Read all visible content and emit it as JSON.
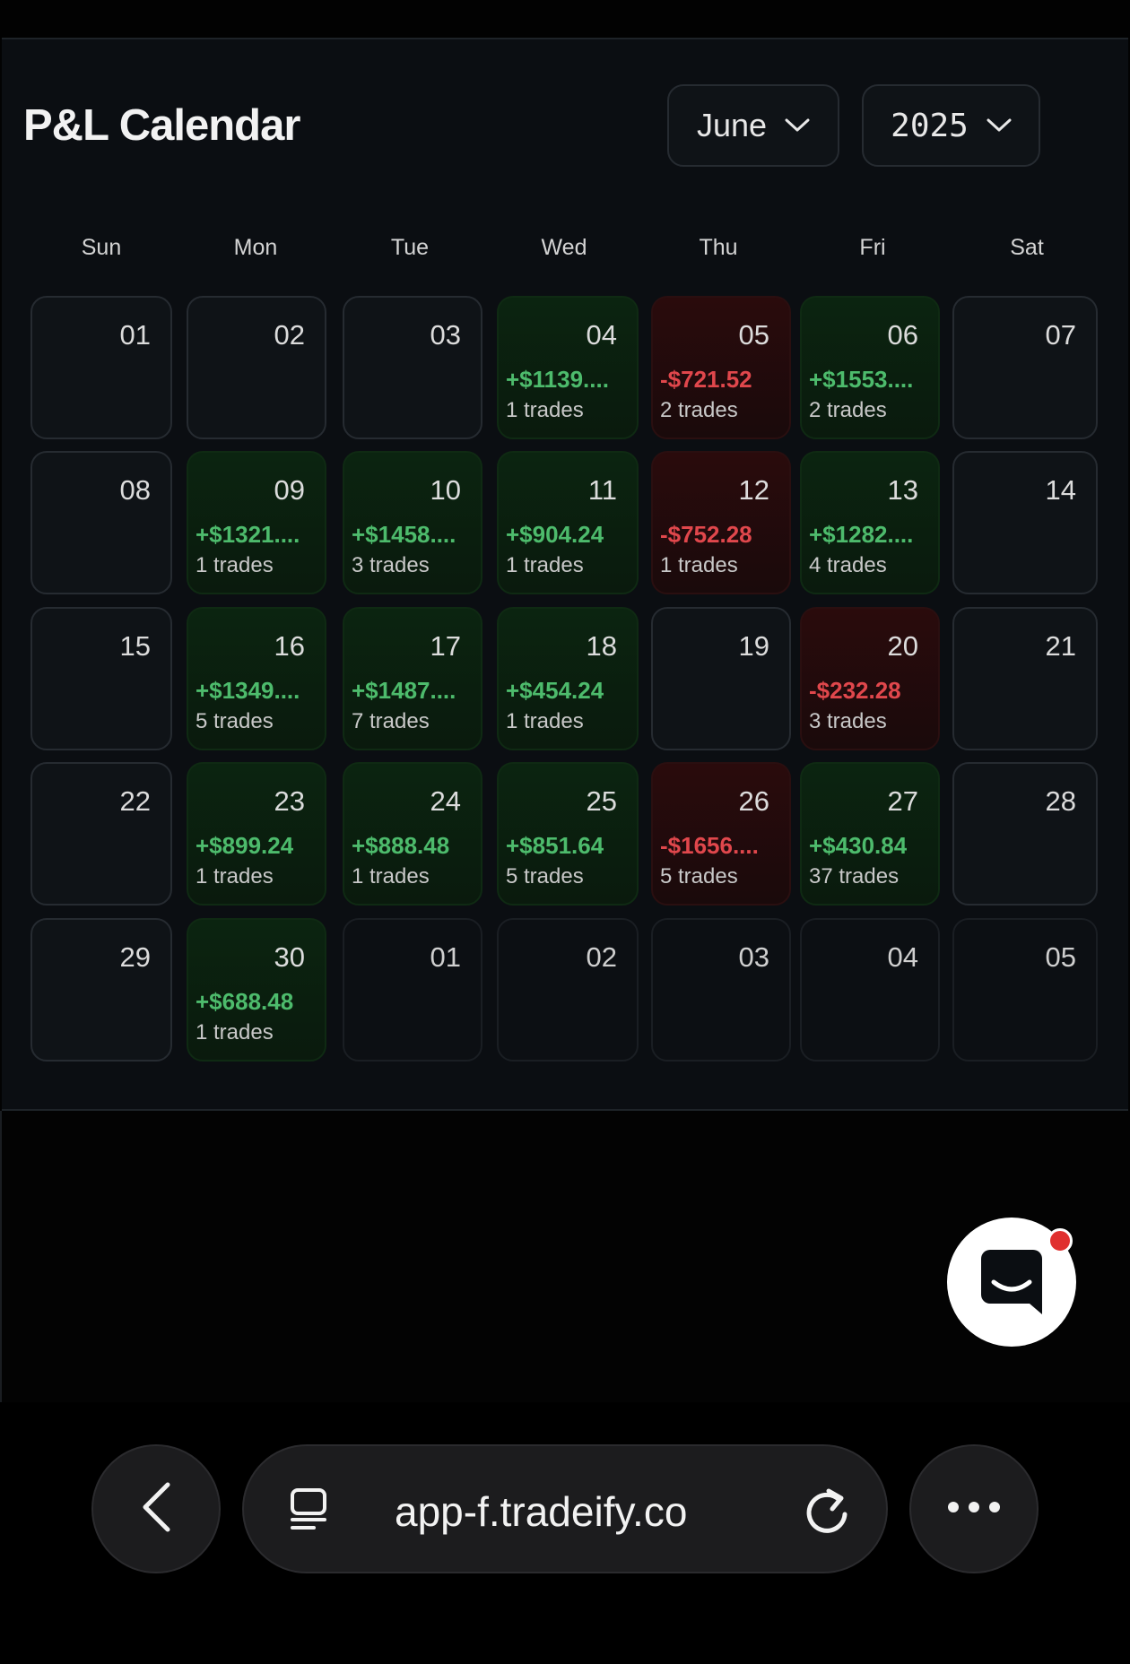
{
  "header": {
    "title": "P&L Calendar"
  },
  "filters": {
    "month": "June",
    "year": "2025"
  },
  "weekdays": [
    "Sun",
    "Mon",
    "Tue",
    "Wed",
    "Thu",
    "Fri",
    "Sat"
  ],
  "days": [
    {
      "day": "01",
      "pnl": "",
      "trades": "",
      "status": "empty"
    },
    {
      "day": "02",
      "pnl": "",
      "trades": "",
      "status": "empty"
    },
    {
      "day": "03",
      "pnl": "",
      "trades": "",
      "status": "empty"
    },
    {
      "day": "04",
      "pnl": "+$1139....",
      "trades": "1 trades",
      "status": "positive"
    },
    {
      "day": "05",
      "pnl": "-$721.52",
      "trades": "2 trades",
      "status": "negative"
    },
    {
      "day": "06",
      "pnl": "+$1553....",
      "trades": "2 trades",
      "status": "positive"
    },
    {
      "day": "07",
      "pnl": "",
      "trades": "",
      "status": "empty"
    },
    {
      "day": "08",
      "pnl": "",
      "trades": "",
      "status": "empty"
    },
    {
      "day": "09",
      "pnl": "+$1321....",
      "trades": "1 trades",
      "status": "positive"
    },
    {
      "day": "10",
      "pnl": "+$1458....",
      "trades": "3 trades",
      "status": "positive"
    },
    {
      "day": "11",
      "pnl": "+$904.24",
      "trades": "1 trades",
      "status": "positive"
    },
    {
      "day": "12",
      "pnl": "-$752.28",
      "trades": "1 trades",
      "status": "negative"
    },
    {
      "day": "13",
      "pnl": "+$1282....",
      "trades": "4 trades",
      "status": "positive"
    },
    {
      "day": "14",
      "pnl": "",
      "trades": "",
      "status": "empty"
    },
    {
      "day": "15",
      "pnl": "",
      "trades": "",
      "status": "empty"
    },
    {
      "day": "16",
      "pnl": "+$1349....",
      "trades": "5 trades",
      "status": "positive"
    },
    {
      "day": "17",
      "pnl": "+$1487....",
      "trades": "7 trades",
      "status": "positive"
    },
    {
      "day": "18",
      "pnl": "+$454.24",
      "trades": "1 trades",
      "status": "positive"
    },
    {
      "day": "19",
      "pnl": "",
      "trades": "",
      "status": "empty"
    },
    {
      "day": "20",
      "pnl": "-$232.28",
      "trades": "3 trades",
      "status": "negative"
    },
    {
      "day": "21",
      "pnl": "",
      "trades": "",
      "status": "empty"
    },
    {
      "day": "22",
      "pnl": "",
      "trades": "",
      "status": "empty"
    },
    {
      "day": "23",
      "pnl": "+$899.24",
      "trades": "1 trades",
      "status": "positive"
    },
    {
      "day": "24",
      "pnl": "+$888.48",
      "trades": "1 trades",
      "status": "positive"
    },
    {
      "day": "25",
      "pnl": "+$851.64",
      "trades": "5 trades",
      "status": "positive"
    },
    {
      "day": "26",
      "pnl": "-$1656....",
      "trades": "5 trades",
      "status": "negative"
    },
    {
      "day": "27",
      "pnl": "+$430.84",
      "trades": "37 trades",
      "status": "positive"
    },
    {
      "day": "28",
      "pnl": "",
      "trades": "",
      "status": "empty"
    },
    {
      "day": "29",
      "pnl": "",
      "trades": "",
      "status": "empty"
    },
    {
      "day": "30",
      "pnl": "+$688.48",
      "trades": "1 trades",
      "status": "positive"
    },
    {
      "day": "01",
      "pnl": "",
      "trades": "",
      "status": "outside"
    },
    {
      "day": "02",
      "pnl": "",
      "trades": "",
      "status": "outside"
    },
    {
      "day": "03",
      "pnl": "",
      "trades": "",
      "status": "outside"
    },
    {
      "day": "04",
      "pnl": "",
      "trades": "",
      "status": "outside"
    },
    {
      "day": "05",
      "pnl": "",
      "trades": "",
      "status": "outside"
    }
  ],
  "colors": {
    "positive": "#4dbb6c",
    "negative": "#e0474c",
    "notification": "#e0302f"
  },
  "browser": {
    "url": "app-f.tradeify.co"
  },
  "icons": {
    "month_dropdown": "chevron-down-icon",
    "year_dropdown": "chevron-down-icon",
    "chat": "chat-bubble-icon",
    "back": "chevron-left-icon",
    "tabs": "tabs-icon",
    "reload": "reload-icon",
    "more": "more-icon"
  }
}
